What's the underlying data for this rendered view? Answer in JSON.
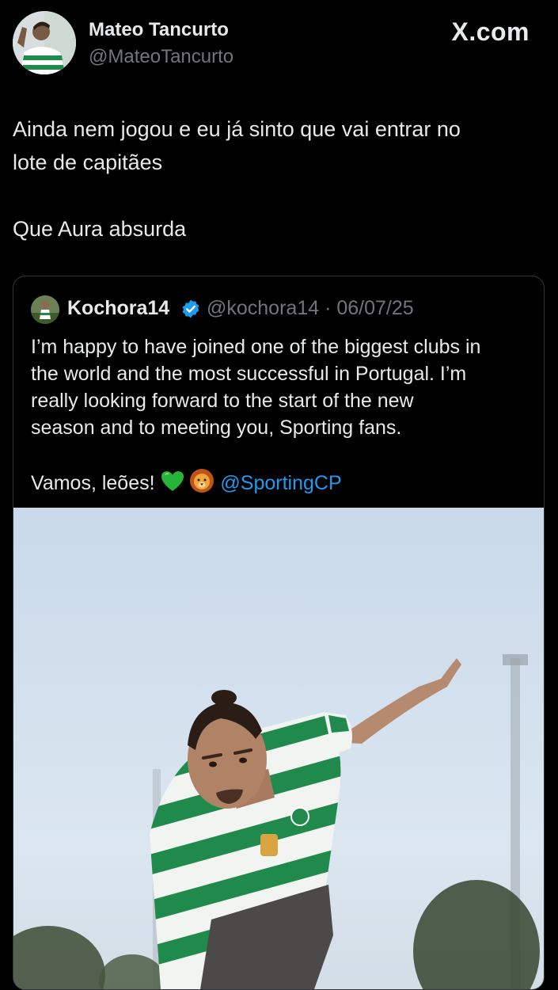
{
  "header": {
    "display_name": "Mateo Tancurto",
    "handle": "@MateoTancurto",
    "brand": "X.com",
    "avatar_icon": "profile-photo-soccer-player"
  },
  "tweet": {
    "lines": [
      "Ainda nem jogou e eu já sinto que vai entrar no",
      "lote de capitães",
      "Que Aura absurda"
    ]
  },
  "quoted": {
    "display_name": "Kochora14",
    "verified_icon": "verified-badge-icon",
    "handle": "@kochora14",
    "separator": "·",
    "date": "06/07/25",
    "lines": [
      "I’m happy to have joined one of the biggest clubs in",
      "the world and the most successful in Portugal. I’m",
      "really looking forward to the start of the new",
      "season and to meeting you, Sporting fans.",
      "Vamos, leões!"
    ],
    "emojis": [
      "green-heart-icon",
      "lion-face-icon"
    ],
    "mention": "@SportingCP",
    "media": "photo-player-green-white-striped-jersey",
    "colors": {
      "accent": "#1d9bf0",
      "jersey_green": "#1f8a4c"
    }
  }
}
